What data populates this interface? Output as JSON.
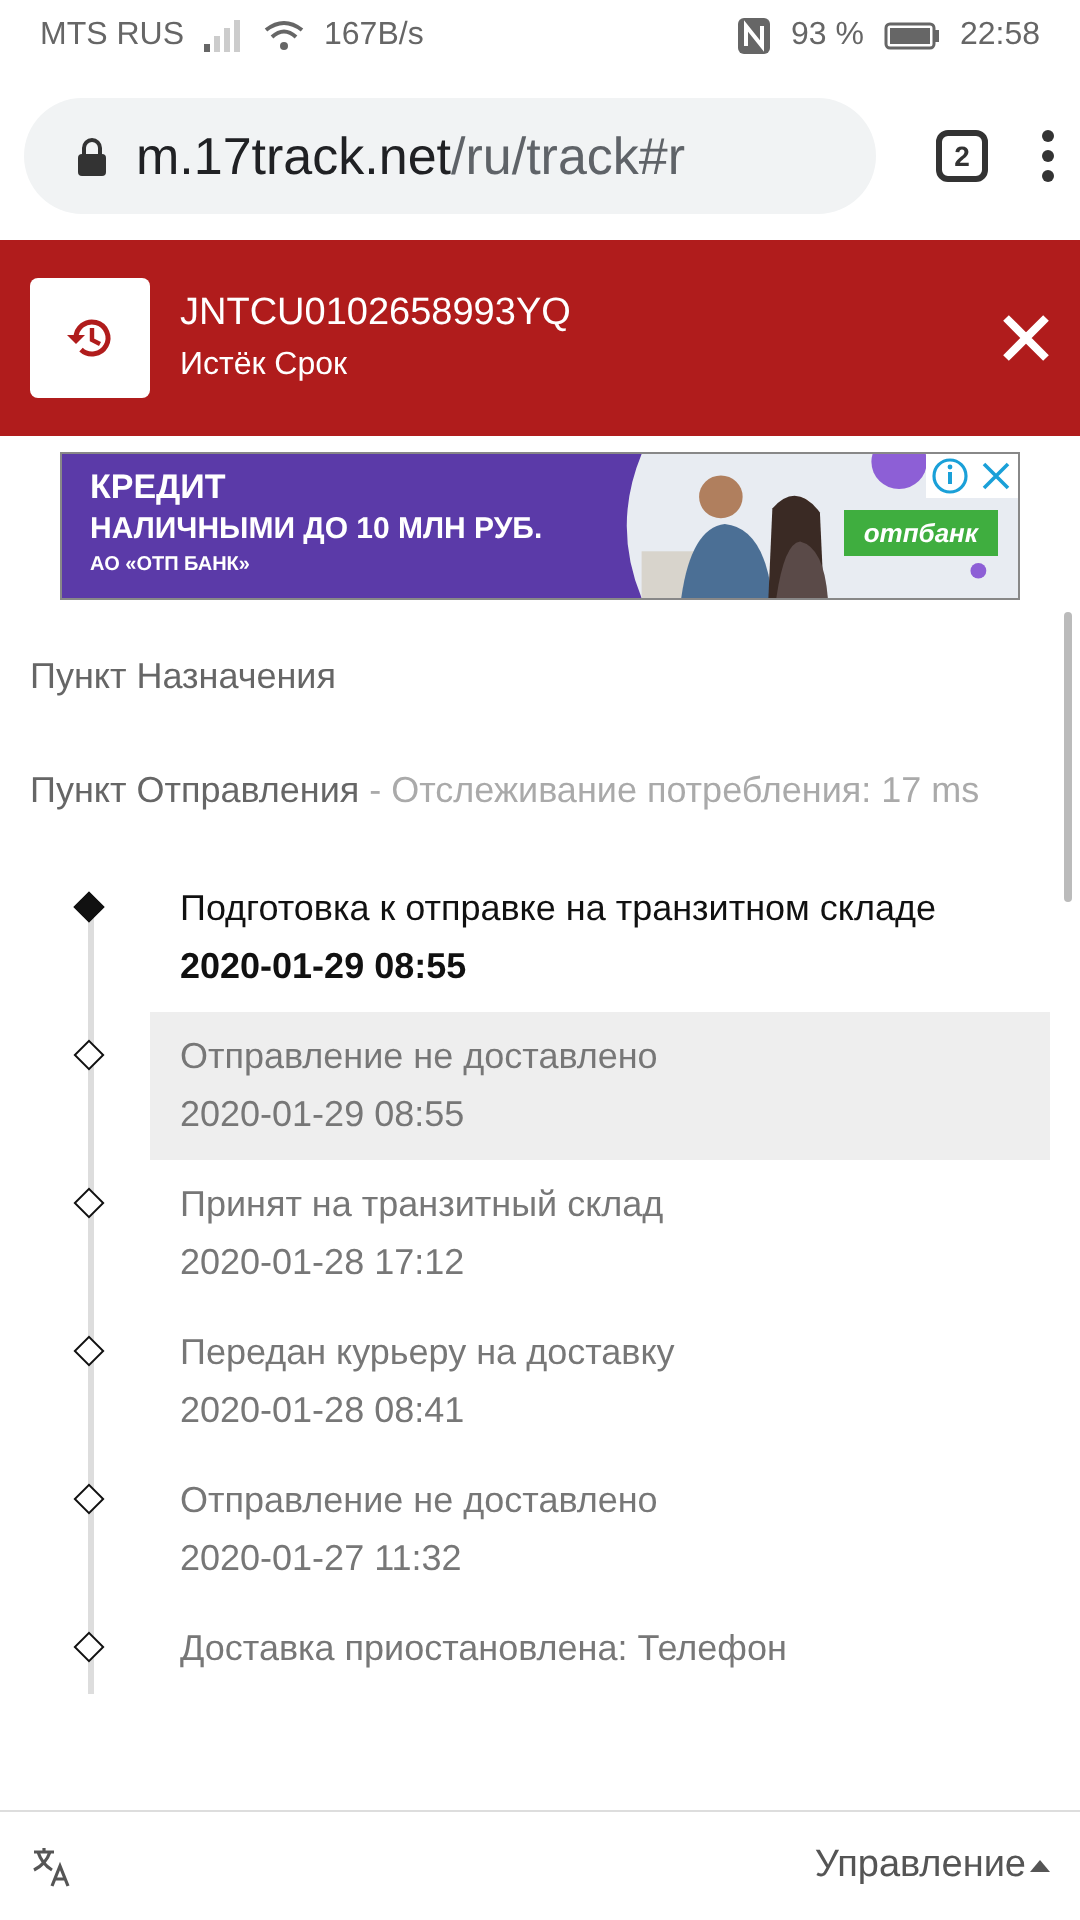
{
  "status_bar": {
    "carrier": "MTS RUS",
    "speed": "167B/s",
    "battery": "93 %",
    "time": "22:58"
  },
  "browser": {
    "url_host": "m.17track.net",
    "url_path": "/ru/track#r",
    "tab_count": "2"
  },
  "header": {
    "tracking_number": "JNTCU0102658993YQ",
    "status": "Истёк Срок"
  },
  "ad": {
    "line_1": "КРЕДИТ",
    "line_2": "НАЛИЧНЫМИ ДО 10 МЛН РУБ.",
    "line_3": "АО «ОТП БАНК»",
    "brand": "отпбанк"
  },
  "destination": {
    "label": "Пункт Назначения"
  },
  "origin": {
    "label": "Пункт Отправления",
    "note": " - Отслеживание потребления: 17 ms"
  },
  "events": [
    {
      "title": "Подготовка к отправке на транзитном складе",
      "time": "2020-01-29 08:55",
      "current": true,
      "selected": false
    },
    {
      "title": "Отправление не доставлено",
      "time": "2020-01-29 08:55",
      "current": false,
      "selected": true
    },
    {
      "title": "Принят на транзитный склад",
      "time": "2020-01-28 17:12",
      "current": false,
      "selected": false
    },
    {
      "title": "Передан курьеру на доставку",
      "time": "2020-01-28 08:41",
      "current": false,
      "selected": false
    },
    {
      "title": "Отправление не доставлено",
      "time": "2020-01-27 11:32",
      "current": false,
      "selected": false
    },
    {
      "title": "Доставка приостановлена: Телефон",
      "current": false,
      "selected": false
    }
  ],
  "footer": {
    "menu": "Управление"
  }
}
